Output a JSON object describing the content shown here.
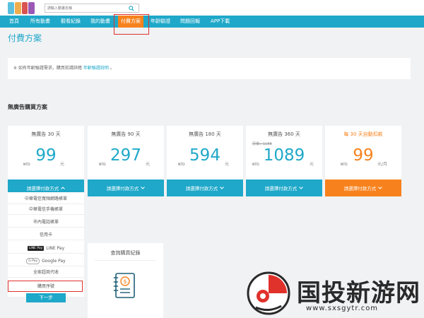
{
  "header": {
    "search_placeholder": "請輸入動畫名稱",
    "logo_colors": [
      "#5bc0de",
      "#f0ad4e",
      "#d9534f",
      "#9b59b6"
    ]
  },
  "nav": {
    "items": [
      "首頁",
      "所有動畫",
      "觀看紀錄",
      "我的動畫",
      "付費方案",
      "年齡驗證",
      "問題回報",
      "APP下載"
    ],
    "active_index": 4
  },
  "page": {
    "title": "付費方案"
  },
  "notice": {
    "text_before": "※ 如有年齡驗證需求，購買前請詳閱",
    "link": "年齡驗證說明",
    "text_after": "。"
  },
  "section": {
    "title": "無廣告購買方案"
  },
  "plans": [
    {
      "name": "無廣告 30 天",
      "currency": "NTD",
      "price": "99",
      "unit": "元",
      "original": "",
      "pay_label": "請選擇付款方式",
      "pay_icon": "chevron-up-icon"
    },
    {
      "name": "無廣告 90 天",
      "currency": "NTD",
      "price": "297",
      "unit": "元",
      "original": "",
      "pay_label": "請選擇付款方式",
      "pay_icon": "chevron-down-icon"
    },
    {
      "name": "無廣告 180 天",
      "currency": "NTD",
      "price": "594",
      "unit": "元",
      "original": "",
      "pay_label": "請選擇付款方式",
      "pay_icon": "chevron-down-icon"
    },
    {
      "name": "無廣告 360 天",
      "currency": "NTD",
      "price": "1089",
      "unit": "元",
      "original": "原價：1188",
      "pay_label": "請選擇付款方式",
      "pay_icon": "chevron-down-icon"
    },
    {
      "name": "每 30 天自動扣款",
      "currency": "NTD",
      "price": "99",
      "unit": "元/月",
      "original": "",
      "pay_label": "請選擇付款方式",
      "pay_icon": "chevron-down-icon"
    }
  ],
  "payment_methods": {
    "items": [
      {
        "label": "中華電信寬頻網路帳單",
        "brand": ""
      },
      {
        "label": "中華電信手機帳單",
        "brand": ""
      },
      {
        "label": "市內電話帳單",
        "brand": ""
      },
      {
        "label": "信用卡",
        "brand": ""
      },
      {
        "label": "LINE Pay",
        "brand": "LINE Pay"
      },
      {
        "label": "Google Pay",
        "brand": "G Pay"
      },
      {
        "label": "全家超商代收",
        "brand": ""
      },
      {
        "label": "購買序號",
        "brand": ""
      }
    ],
    "next": "下一步"
  },
  "record": {
    "title": "查詢購買紀錄",
    "icon": "receipt-dollar-icon"
  },
  "watermark": {
    "text": "国投新游网",
    "url": "www.sxsgytr.com"
  },
  "colors": {
    "accent": "#1fa8c9",
    "active": "#f7821d",
    "highlight": "#e0312b"
  }
}
